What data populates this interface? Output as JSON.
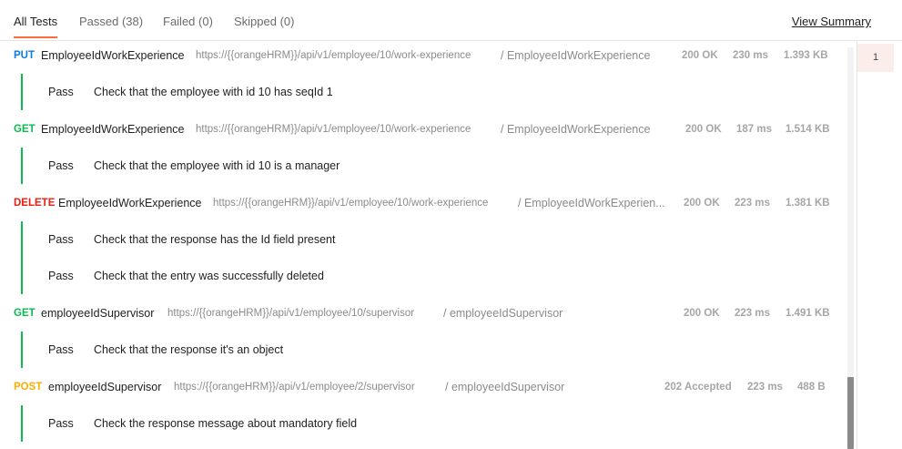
{
  "tabs": [
    {
      "label": "All Tests"
    },
    {
      "label": "Passed (38)"
    },
    {
      "label": "Failed (0)"
    },
    {
      "label": "Skipped (0)"
    }
  ],
  "view_summary": "View Summary",
  "requests": [
    {
      "method": "PUT",
      "name": "EmployeeIdWorkExperience",
      "url": "https://{{orangeHRM}}/api/v1/employee/10/work-experience",
      "path": "/ EmployeeIdWorkExperience",
      "status": "200 OK",
      "time": "230 ms",
      "size": "1.393 KB",
      "tests": [
        {
          "status": "Pass",
          "name": "Check that the employee with id 10 has seqId 1"
        }
      ]
    },
    {
      "method": "GET",
      "name": "EmployeeIdWorkExperience",
      "url": "https://{{orangeHRM}}/api/v1/employee/10/work-experience",
      "path": "/ EmployeeIdWorkExperience",
      "status": "200 OK",
      "time": "187 ms",
      "size": "1.514 KB",
      "tests": [
        {
          "status": "Pass",
          "name": "Check that the employee with id 10 is a manager"
        }
      ]
    },
    {
      "method": "DELETE",
      "name": "EmployeeIdWorkExperience",
      "url": "https://{{orangeHRM}}/api/v1/employee/10/work-experience",
      "path": "/ EmployeeIdWorkExperien...",
      "status": "200 OK",
      "time": "223 ms",
      "size": "1.381 KB",
      "tests": [
        {
          "status": "Pass",
          "name": "Check that the response has the Id field present"
        },
        {
          "status": "Pass",
          "name": "Check that the entry was successfully deleted"
        }
      ]
    },
    {
      "method": "GET",
      "name": "employeeIdSupervisor",
      "url": "https://{{orangeHRM}}/api/v1/employee/10/supervisor",
      "path": "/ employeeIdSupervisor",
      "status": "200 OK",
      "time": "223 ms",
      "size": "1.491 KB",
      "tests": [
        {
          "status": "Pass",
          "name": "Check that the response it's an object"
        }
      ]
    },
    {
      "method": "POST",
      "name": "employeeIdSupervisor",
      "url": "https://{{orangeHRM}}/api/v1/employee/2/supervisor",
      "path": "/ employeeIdSupervisor",
      "status": "202 Accepted",
      "time": "223 ms",
      "size": "488 B",
      "tests": [
        {
          "status": "Pass",
          "name": "Check the response message about mandatory field"
        }
      ]
    }
  ],
  "iterations": [
    "1"
  ],
  "colors": {
    "put": "#097bed",
    "get": "#0cbb52",
    "delete": "#eb2013",
    "post": "#ffad00",
    "pass_bar": "#0cbb52",
    "active_tab_underline": "#ff6c37"
  }
}
